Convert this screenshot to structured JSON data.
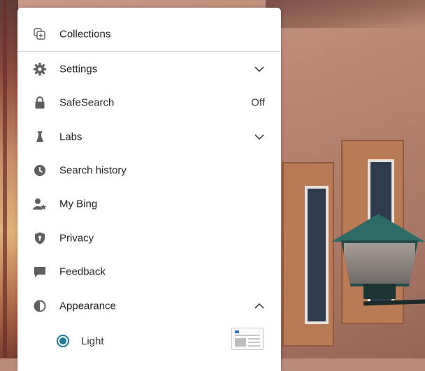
{
  "menu": {
    "items": [
      {
        "label": "Collections",
        "icon": "collections-icon"
      },
      {
        "label": "Settings",
        "icon": "gear-icon"
      },
      {
        "label": "SafeSearch",
        "icon": "lock-icon",
        "value": "Off"
      },
      {
        "label": "Labs",
        "icon": "flask-icon"
      },
      {
        "label": "Search history",
        "icon": "clock-icon"
      },
      {
        "label": "My Bing",
        "icon": "user-star-icon"
      },
      {
        "label": "Privacy",
        "icon": "shield-icon"
      },
      {
        "label": "Feedback",
        "icon": "feedback-icon"
      },
      {
        "label": "Appearance",
        "icon": "contrast-icon"
      }
    ],
    "appearance_options": [
      {
        "label": "Light",
        "selected": true
      }
    ]
  },
  "colors": {
    "icon": "#5f5f5f",
    "accent": "#1f7a99",
    "text": "#222222"
  }
}
